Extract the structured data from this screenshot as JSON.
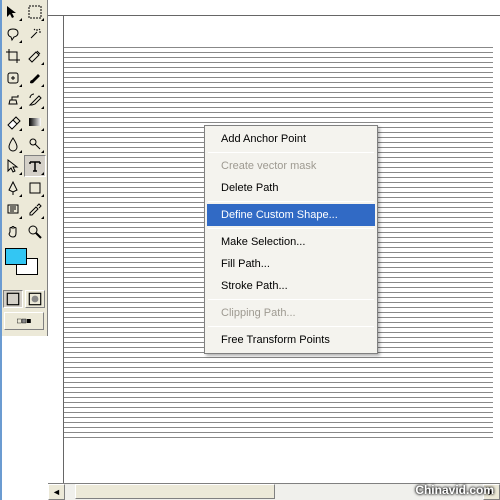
{
  "toolbox": {
    "tools": [
      {
        "name": "move-tool"
      },
      {
        "name": "marquee-tool"
      },
      {
        "name": "lasso-tool"
      },
      {
        "name": "magic-wand-tool"
      },
      {
        "name": "crop-tool"
      },
      {
        "name": "slice-tool"
      },
      {
        "name": "healing-brush-tool"
      },
      {
        "name": "brush-tool"
      },
      {
        "name": "clone-stamp-tool"
      },
      {
        "name": "history-brush-tool"
      },
      {
        "name": "eraser-tool"
      },
      {
        "name": "gradient-tool"
      },
      {
        "name": "blur-tool"
      },
      {
        "name": "dodge-tool"
      },
      {
        "name": "path-selection-tool"
      },
      {
        "name": "type-tool"
      },
      {
        "name": "pen-tool"
      },
      {
        "name": "shape-tool"
      },
      {
        "name": "notes-tool"
      },
      {
        "name": "eyedropper-tool"
      },
      {
        "name": "hand-tool"
      },
      {
        "name": "zoom-tool"
      }
    ],
    "fg_color": "#33c6f3",
    "bg_color": "#ffffff"
  },
  "context_menu": {
    "items": [
      {
        "label": "Add Anchor Point",
        "enabled": true
      },
      {
        "sep": true
      },
      {
        "label": "Create vector mask",
        "enabled": false
      },
      {
        "label": "Delete Path",
        "enabled": true
      },
      {
        "sep": true
      },
      {
        "label": "Define Custom Shape...",
        "enabled": true,
        "highlight": true
      },
      {
        "sep": true
      },
      {
        "label": "Make Selection...",
        "enabled": true
      },
      {
        "label": "Fill Path...",
        "enabled": true
      },
      {
        "label": "Stroke Path...",
        "enabled": true
      },
      {
        "sep": true
      },
      {
        "label": "Clipping Path...",
        "enabled": false
      },
      {
        "sep": true
      },
      {
        "label": "Free Transform Points",
        "enabled": true
      }
    ]
  },
  "watermark": "Chinavid.com"
}
